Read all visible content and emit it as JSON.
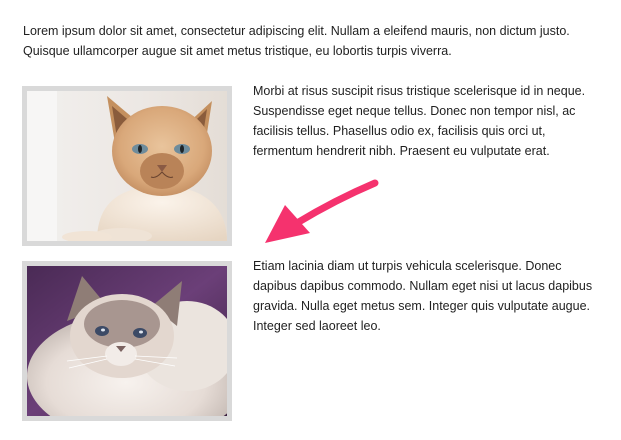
{
  "intro_text": "Lorem ipsum dolor sit amet, consectetur adipiscing elit. Nullam a eleifend mauris, non dictum justo. Quisque ullamcorper augue sit amet metus tristique, eu lobortis turpis viverra.",
  "items": [
    {
      "image": "cat-photo-siamese",
      "text": "Morbi at risus suscipit risus tristique scelerisque id in neque. Suspendisse eget neque tellus. Donec non tempor nisl, ac facilisis tellus. Phasellus odio ex, facilisis quis orci ut, fermentum hendrerit nibh. Praesent eu vulputate erat."
    },
    {
      "image": "cat-photo-ragdoll",
      "text": "Etiam lacinia diam ut turpis vehicula scelerisque. Donec dapibus dapibus commodo. Nullam eget nisi ut lacus dapibus gravida. Nulla eget metus sem. Integer quis vulputate augue. Integer sed laoreet leo."
    }
  ],
  "annotation": {
    "icon": "arrow-annotation-icon",
    "color": "#f5326e"
  }
}
